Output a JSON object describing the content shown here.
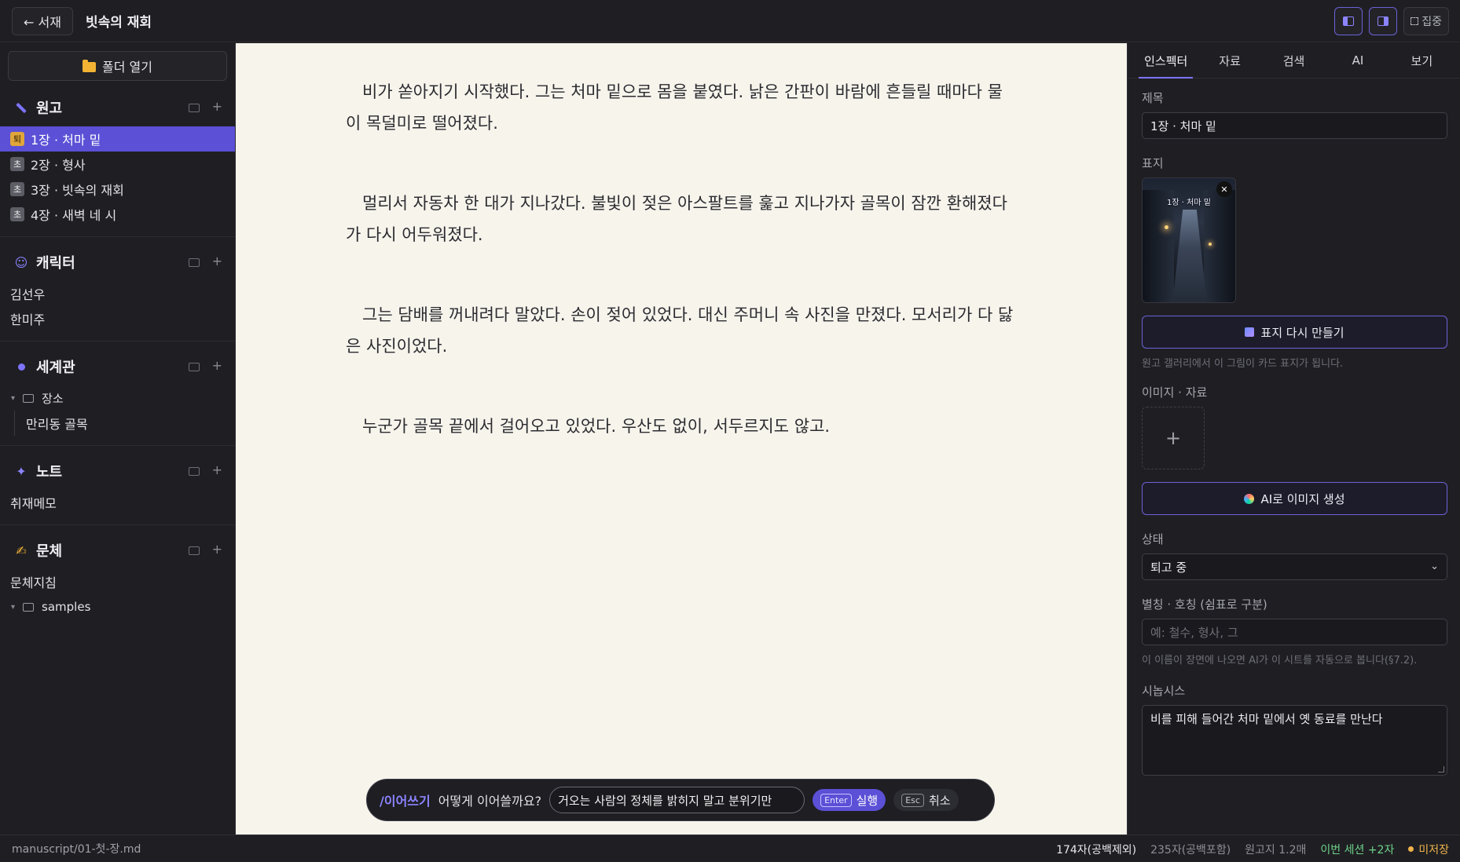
{
  "topbar": {
    "back_label": "← 서재",
    "title": "빗속의 재회",
    "focus_label": "집중"
  },
  "sidebar": {
    "open_folder_label": "폴더 열기",
    "manuscript": {
      "title": "원고",
      "items": [
        {
          "badge": "퇴",
          "label": "1장 · 처마 밑"
        },
        {
          "badge": "초",
          "label": "2장 · 형사"
        },
        {
          "badge": "초",
          "label": "3장 · 빗속의 재회"
        },
        {
          "badge": "초",
          "label": "4장 · 새벽 네 시"
        }
      ]
    },
    "characters": {
      "title": "캐릭터",
      "items": [
        "김선우",
        "한미주"
      ]
    },
    "world": {
      "title": "세계관",
      "folder": "장소",
      "child": "만리동 골목"
    },
    "notes": {
      "title": "노트",
      "items": [
        "취재메모"
      ]
    },
    "style": {
      "title": "문체",
      "item": "문체지침",
      "folder": "samples"
    }
  },
  "editor": {
    "paragraphs": [
      "비가 쏟아지기 시작했다. 그는 처마 밑으로 몸을 붙였다. 낡은 간판이 바람에 흔들릴 때마다 물이 목덜미로 떨어졌다.",
      "멀리서 자동차 한 대가 지나갔다. 불빛이 젖은 아스팔트를 훑고 지나가자 골목이 잠깐 환해졌다가 다시 어두워졌다.",
      "그는 담배를 꺼내려다 말았다. 손이 젖어 있었다. 대신 주머니 속 사진을 만졌다. 모서리가 다 닳은 사진이었다.",
      "누군가 골목 끝에서 걸어오고 있었다. 우산도 없이, 서두르지도 않고."
    ],
    "command": {
      "slash": "/이어쓰기",
      "question": "어떻게 이어쓸까요?",
      "input_value": "거오는 사람의 정체를 밝히지 말고 분위기만",
      "run_key": "Enter",
      "run_label": "실행",
      "cancel_key": "Esc",
      "cancel_label": "취소"
    }
  },
  "inspector": {
    "tabs": [
      "인스펙터",
      "자료",
      "검색",
      "AI",
      "보기"
    ],
    "title_label": "제목",
    "title_value": "1장 · 처마 밑",
    "cover_label": "표지",
    "cover_caption": "1장 · 처마 밑",
    "regen_cover_label": "표지 다시 만들기",
    "cover_hint": "원고 갤러리에서 이 그림이 카드 표지가 됩니다.",
    "images_label": "이미지 · 자료",
    "add_symbol": "+",
    "ai_image_label": "AI로 이미지 생성",
    "status_label": "상태",
    "status_value": "퇴고 중",
    "alias_label": "별칭 · 호칭 (쉼표로 구분)",
    "alias_placeholder": "예: 철수, 형사, 그",
    "alias_hint": "이 이름이 장면에 나오면 AI가 이 시트를 자동으로 봅니다(§7.2).",
    "synopsis_label": "시놉시스",
    "synopsis_value": "비를 피해 들어간 처마 밑에서 옛 동료를 만난다"
  },
  "statusbar": {
    "path": "manuscript/01-첫-장.md",
    "chars_no_space": "174자(공백제외)",
    "chars_with_space": "235자(공백포함)",
    "manuscript_pages": "원고지 1.2매",
    "session": "이번 세션 +2자",
    "unsaved": "미저장"
  }
}
